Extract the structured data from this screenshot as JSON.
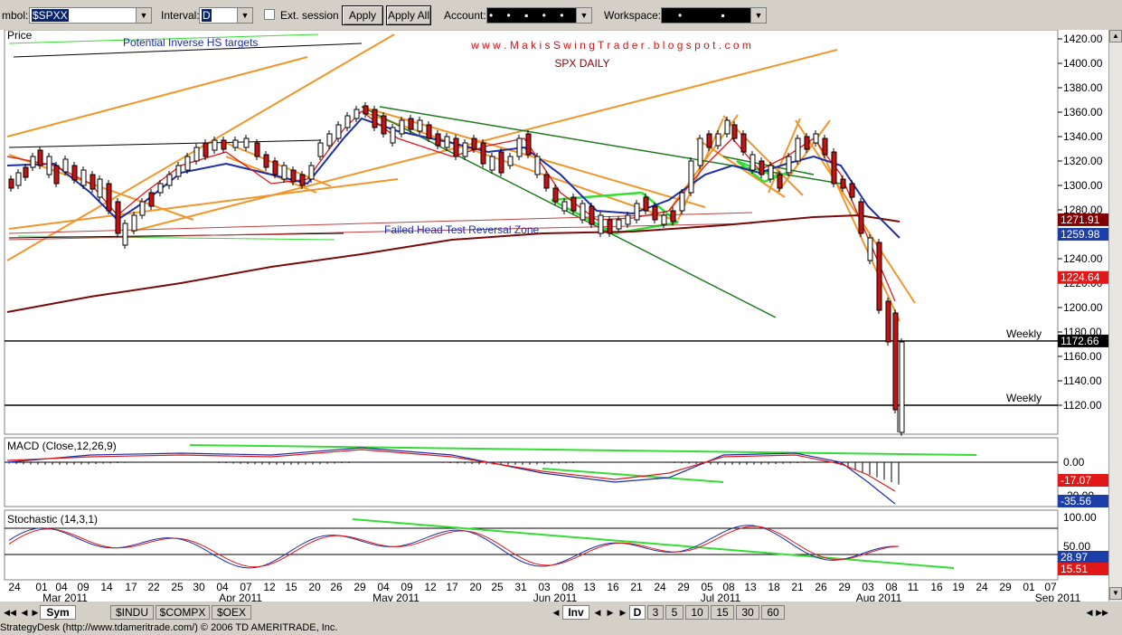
{
  "toolbar": {
    "symbol_label": "mbol:",
    "symbol_value": "$SPXX",
    "interval_label": "Interval:",
    "interval_value": "D",
    "ext_session_label": "Ext. session",
    "apply_label": "Apply",
    "apply_all_label": "Apply All",
    "account_label": "Account:",
    "account_value": "• • ▪ • •",
    "workspace_label": "Workspace:",
    "workspace_value": "• ▪"
  },
  "chart": {
    "title_url": "w w w . M a k i s S w i n g T r a d e r . b l o g s p o t . c o m",
    "subtitle": "SPX DAILY",
    "panel_price_label": "Price",
    "annotation_hs": "Potential Inverse HS targets",
    "annotation_failed": "Failed Head Test Reversal Zone",
    "weekly_label_1": "Weekly",
    "weekly_label_2": "Weekly",
    "price_ticks": [
      "1420.00",
      "1400.00",
      "1380.00",
      "1360.00",
      "1340.00",
      "1320.00",
      "1300.00",
      "1280.00",
      "1260.00",
      "1240.00",
      "1220.00",
      "1200.00",
      "1180.00",
      "1160.00",
      "1140.00",
      "1120.00"
    ],
    "price_badges": [
      {
        "text": "1271.91",
        "color": "#800000",
        "value": 1271.91
      },
      {
        "text": "1259.98",
        "color": "#1c3ea8",
        "value": 1259.98
      },
      {
        "text": "1224.64",
        "color": "#e01818",
        "value": 1224.64
      },
      {
        "text": "1172.66",
        "color": "#000000",
        "value": 1172.66
      }
    ],
    "macd_label": "MACD (Close,12,26,9)",
    "macd_ticks": [
      "0.00",
      "-20.00"
    ],
    "macd_badges": [
      {
        "text": "-17.07",
        "color": "#e01818"
      },
      {
        "text": "-35.56",
        "color": "#1c3ea8"
      }
    ],
    "stoch_label": "Stochastic (14,3,1)",
    "stoch_ticks": [
      "100.00",
      "50.00"
    ],
    "stoch_badges": [
      {
        "text": "28.97",
        "color": "#1c3ea8"
      },
      {
        "text": "15.51",
        "color": "#e01818"
      }
    ],
    "date_days": [
      "24",
      "01",
      "04",
      "09",
      "14",
      "17",
      "22",
      "25",
      "30",
      "04",
      "07",
      "12",
      "15",
      "20",
      "26",
      "29",
      "04",
      "09",
      "12",
      "17",
      "20",
      "25",
      "31",
      "03",
      "08",
      "13",
      "16",
      "21",
      "24",
      "29",
      "05",
      "08",
      "13",
      "18",
      "21",
      "26",
      "29",
      "03",
      "08",
      "11",
      "16",
      "19",
      "24",
      "29",
      "01",
      "07"
    ],
    "month_labels": [
      "Mar 2011",
      "Apr 2011",
      "May 2011",
      "Jun 2011",
      "Jul 2011",
      "Aug 2011",
      "Sep 2011"
    ]
  },
  "bottom": {
    "tabs_left": [
      "Sym",
      "$INDU",
      "$COMPX",
      "$OEX"
    ],
    "inv_label": "Inv",
    "interval_tabs": [
      "D",
      "3",
      "5",
      "10",
      "15",
      "30",
      "60"
    ]
  },
  "status": "StrategyDesk (http://www.tdameritrade.com/) © 2006 TD AMERITRADE, Inc.",
  "colors": {
    "ma_blue": "#1c2ea8",
    "ma_red": "#e01818",
    "ma_maroon": "#7a0a0a",
    "trend_orange": "#f0962a",
    "trend_green": "#1e7a1e",
    "light_green": "#33dd33"
  }
}
